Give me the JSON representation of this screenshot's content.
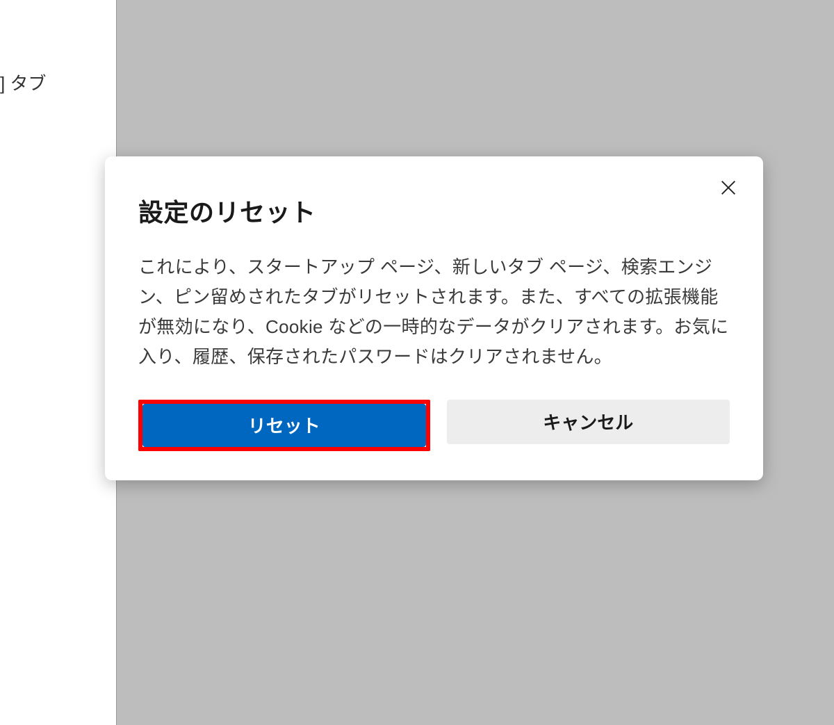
{
  "background": {
    "text_fragment": "] タブ"
  },
  "dialog": {
    "title": "設定のリセット",
    "body": "これにより、スタートアップ ページ、新しいタブ ページ、検索エンジン、ピン留めされたタブがリセットされます。また、すべての拡張機能が無効になり、Cookie などの一時的なデータがクリアされます。お気に入り、履歴、保存されたパスワードはクリアされません。",
    "primary_button": "リセット",
    "secondary_button": "キャンセル"
  },
  "colors": {
    "primary_button_bg": "#0067c0",
    "highlight_border": "#ff0000",
    "secondary_button_bg": "#ededed"
  }
}
